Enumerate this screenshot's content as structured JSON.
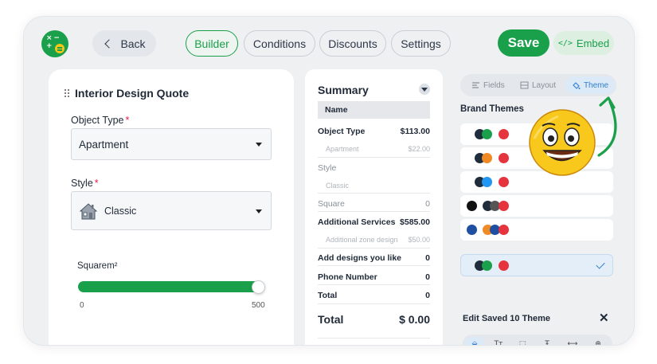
{
  "header": {
    "back_label": "Back",
    "tabs": [
      {
        "label": "Builder",
        "active": true
      },
      {
        "label": "Conditions",
        "active": false
      },
      {
        "label": "Discounts",
        "active": false
      },
      {
        "label": "Settings",
        "active": false
      }
    ],
    "save_label": "Save",
    "embed_label": "Embed",
    "embed_icon": "</>"
  },
  "form": {
    "title": "Interior Design Quote",
    "object_type": {
      "label": "Object Type",
      "required_mark": "*",
      "value": "Apartment"
    },
    "style": {
      "label": "Style",
      "required_mark": "*",
      "value": "Classic",
      "icon": "house-icon"
    },
    "square": {
      "label": "Squarem²",
      "min": "0",
      "max": "500",
      "value_fraction": 1.0
    }
  },
  "summary": {
    "title": "Summary",
    "name_label": "Name",
    "rows": [
      {
        "kind": "main",
        "label": "Object Type",
        "value": "$113.00"
      },
      {
        "kind": "sub",
        "label": "Apartment",
        "value": "$22.00"
      },
      {
        "kind": "plain",
        "label": "Style",
        "value": ""
      },
      {
        "kind": "sub",
        "label": "Classic",
        "value": ""
      },
      {
        "kind": "plain",
        "label": "Square",
        "value": "0"
      },
      {
        "kind": "main",
        "label": "Additional Services",
        "value": "$585.00"
      },
      {
        "kind": "sub",
        "label": "Additional zone design",
        "value": "$50.00"
      },
      {
        "kind": "main",
        "label": "Add designs you like",
        "value": "0"
      },
      {
        "kind": "main",
        "label": "Phone Number",
        "value": "0"
      },
      {
        "kind": "main",
        "label": "Total",
        "value": "0"
      }
    ],
    "total_label": "Total",
    "total_value": "$ 0.00"
  },
  "theme_panel": {
    "tabs": [
      {
        "label": "Fields",
        "icon": "fields-icon",
        "active": false
      },
      {
        "label": "Layout",
        "icon": "layout-icon",
        "active": false
      },
      {
        "label": "Theme",
        "icon": "paint-bucket-icon",
        "active": true
      }
    ],
    "brand_title": "Brand Themes",
    "themes": [
      {
        "colors": [
          "#1f2d3d",
          "#1aa04a",
          "#e5343d"
        ]
      },
      {
        "colors": [
          "#1f2d3d",
          "#f08a24",
          "#e5343d"
        ]
      },
      {
        "colors": [
          "#1f2d3d",
          "#2196f3",
          "#e5343d"
        ]
      },
      {
        "colors": [
          "#111111",
          "#1f2d3d",
          "#555555",
          "#e5343d"
        ]
      },
      {
        "colors": [
          "#1f4fa0",
          "#f08a24",
          "#1f4fa0",
          "#e5343d"
        ]
      }
    ],
    "selected_theme": {
      "colors": [
        "#1f2d3d",
        "#1aa04a",
        "#e5343d"
      ]
    },
    "edit_title": "Edit Saved 10 Theme",
    "tools": [
      "paint-bucket-icon",
      "text-size-icon",
      "border-icon",
      "font-icon",
      "width-icon",
      "download-icon"
    ]
  },
  "colors": {
    "accent": "#1aa04a",
    "theme_blue": "#2f7dd1"
  }
}
